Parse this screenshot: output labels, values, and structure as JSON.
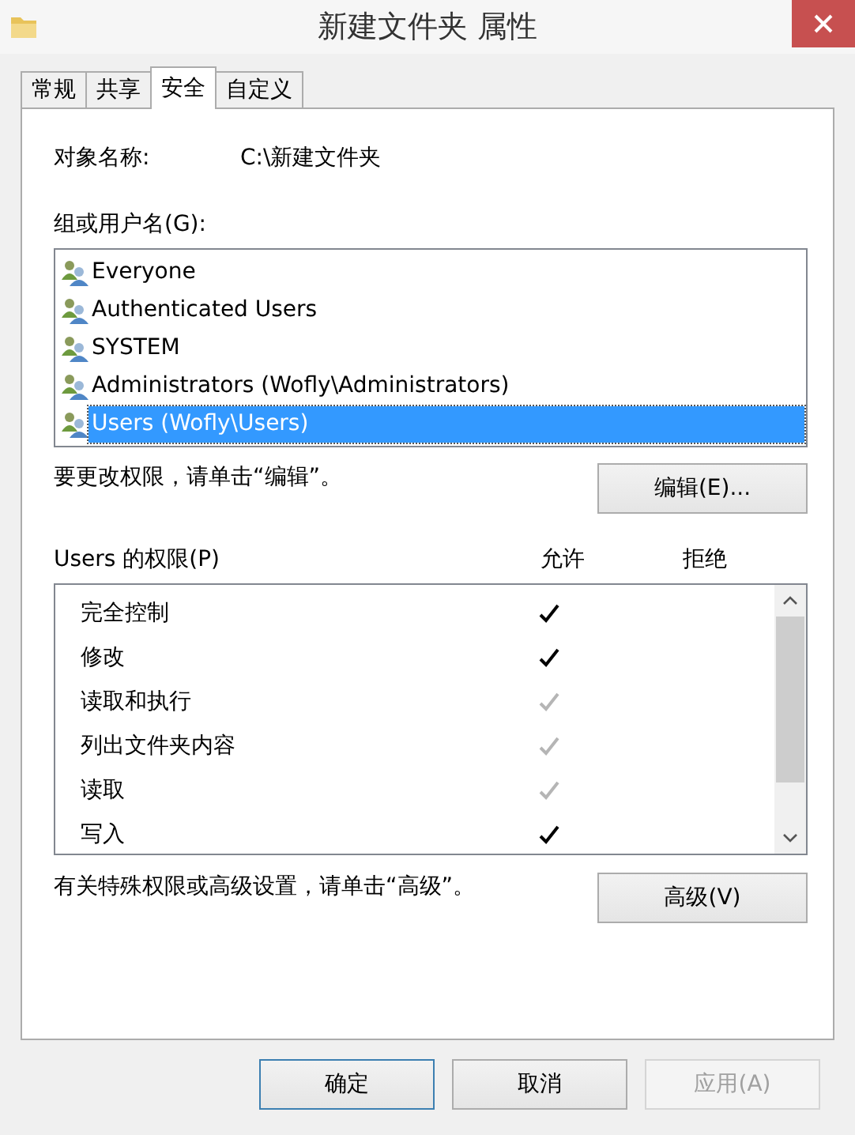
{
  "window": {
    "title": "新建文件夹 属性"
  },
  "tabs": [
    {
      "label": "常规",
      "selected": false
    },
    {
      "label": "共享",
      "selected": false
    },
    {
      "label": "安全",
      "selected": true
    },
    {
      "label": "自定义",
      "selected": false
    }
  ],
  "object_name": {
    "label": "对象名称:",
    "value": "C:\\新建文件夹"
  },
  "groups": {
    "label": "组或用户名(G):",
    "items": [
      {
        "name": "Everyone",
        "selected": false
      },
      {
        "name": "Authenticated Users",
        "selected": false
      },
      {
        "name": "SYSTEM",
        "selected": false
      },
      {
        "name": "Administrators (Wofly\\Administrators)",
        "selected": false
      },
      {
        "name": "Users (Wofly\\Users)",
        "selected": true
      }
    ]
  },
  "edit_hint": "要更改权限，请单击“编辑”。",
  "edit_button": "编辑(E)...",
  "permissions": {
    "label": "Users 的权限(P)",
    "allow_header": "允许",
    "deny_header": "拒绝",
    "rows": [
      {
        "name": "完全控制",
        "allow": true,
        "inherited": false
      },
      {
        "name": "修改",
        "allow": true,
        "inherited": false
      },
      {
        "name": "读取和执行",
        "allow": true,
        "inherited": true
      },
      {
        "name": "列出文件夹内容",
        "allow": true,
        "inherited": true
      },
      {
        "name": "读取",
        "allow": true,
        "inherited": true
      },
      {
        "name": "写入",
        "allow": true,
        "inherited": false
      }
    ]
  },
  "advanced_hint": "有关特殊权限或高级设置，请单击“高级”。",
  "advanced_button": "高级(V)",
  "buttons": [
    {
      "label": "确定",
      "kind": "default",
      "disabled": false
    },
    {
      "label": "取消",
      "kind": "normal",
      "disabled": false
    },
    {
      "label": "应用(A)",
      "kind": "normal",
      "disabled": true
    }
  ]
}
